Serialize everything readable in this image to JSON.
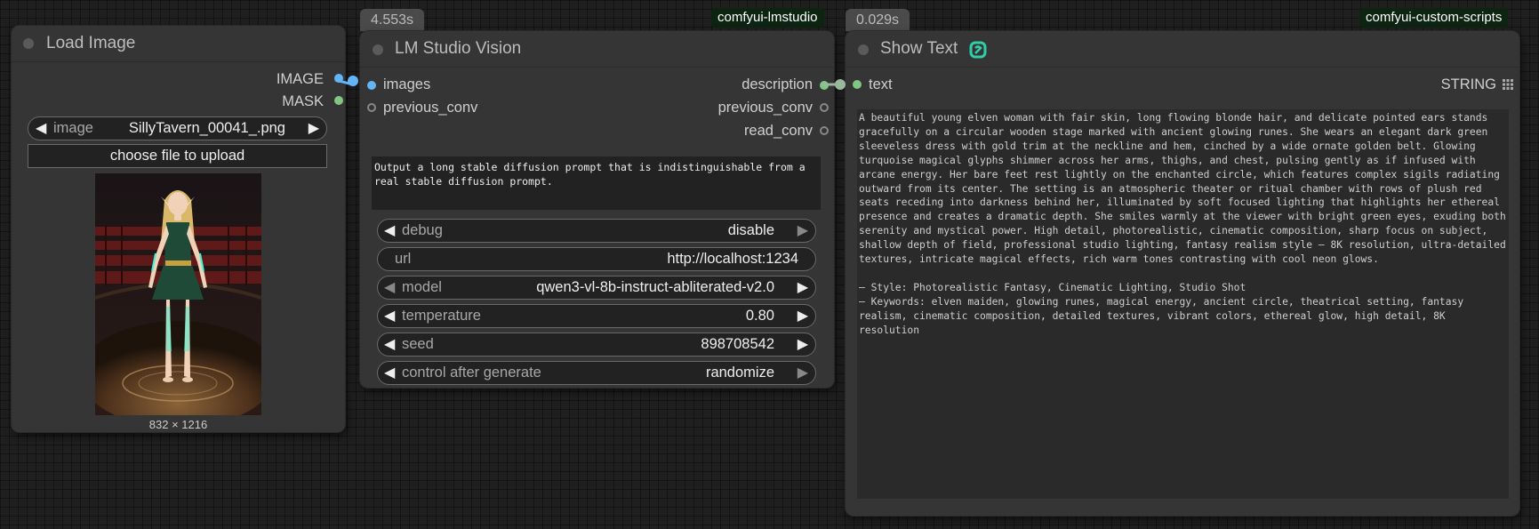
{
  "load_image": {
    "title": "Load Image",
    "outputs": [
      {
        "label": "IMAGE",
        "color": "#64b5f6"
      },
      {
        "label": "MASK",
        "color": "#81c784"
      }
    ],
    "image_widget": {
      "label": "image",
      "value": "SillyTavern_00041_.png"
    },
    "upload_button": "choose file to upload",
    "preview_caption": "832 × 1216"
  },
  "lm_studio": {
    "timing": "4.553s",
    "badge": "comfyui-lmstudio",
    "title": "LM Studio Vision",
    "inputs": [
      {
        "label": "images",
        "color": "#64b5f6",
        "connected": true
      },
      {
        "label": "previous_conv",
        "color": "#999999",
        "connected": false
      }
    ],
    "outputs": [
      {
        "label": "description",
        "color": "#81c784",
        "connected": true
      },
      {
        "label": "previous_conv",
        "color": "#999999",
        "connected": false
      },
      {
        "label": "read_conv",
        "color": "#999999",
        "connected": false
      }
    ],
    "prompt": "Output a long stable diffusion prompt that is indistinguishable from a real stable diffusion prompt.",
    "widgets": [
      {
        "label": "debug",
        "value": "disable"
      },
      {
        "label": "url",
        "value": "http://localhost:1234"
      },
      {
        "label": "model",
        "value": "qwen3-vl-8b-instruct-abliterated-v2.0"
      },
      {
        "label": "temperature",
        "value": "0.80"
      },
      {
        "label": "seed",
        "value": "898708542"
      },
      {
        "label": "control after generate",
        "value": "randomize"
      }
    ]
  },
  "show_text": {
    "timing": "0.029s",
    "badge": "comfyui-custom-scripts",
    "title": "Show Text",
    "title_icon": "link-icon",
    "input_label": "text",
    "output_label": "STRING",
    "output_icon": "grid-icon",
    "text": "A beautiful young elven woman with fair skin, long flowing blonde hair, and delicate pointed ears stands gracefully on a circular wooden stage marked with ancient glowing runes. She wears an elegant dark green sleeveless dress with gold trim at the neckline and hem, cinched by a wide ornate golden belt. Glowing turquoise magical glyphs shimmer across her arms, thighs, and chest, pulsing gently as if infused with arcane energy. Her bare feet rest lightly on the enchanted circle, which features complex sigils radiating outward from its center. The setting is an atmospheric theater or ritual chamber with rows of plush red seats receding into darkness behind her, illuminated by soft focused lighting that highlights her ethereal presence and creates a dramatic depth. She smiles warmly at the viewer with bright green eyes, exuding both serenity and mystical power. High detail, photorealistic, cinematic composition, sharp focus on subject, shallow depth of field, professional studio lighting, fantasy realism style — 8K resolution, ultra-detailed textures, intricate magical effects, rich warm tones contrasting with cool neon glows.\n\n— Style: Photorealistic Fantasy, Cinematic Lighting, Studio Shot\n— Keywords: elven maiden, glowing runes, magical energy, ancient circle, theatrical setting, fantasy realism, cinematic composition, detailed textures, vibrant colors, ethereal glow, high detail, 8K resolution"
  },
  "colors": {
    "image_link": "#64b5f6",
    "string_link": "#9cb89c",
    "badge_bg": "#0d2510"
  }
}
